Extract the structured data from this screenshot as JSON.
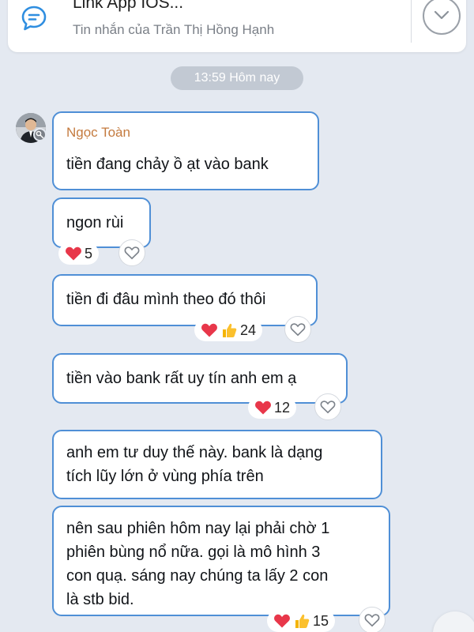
{
  "pinned": {
    "title": "Link App IOS...",
    "subtitle": "Tin nhắn của Trần Thị Hồng Hạnh",
    "icon": "chat-bubble-icon"
  },
  "time_divider": "13:59 Hôm nay",
  "sender": {
    "name": "Ngọc Toàn"
  },
  "messages": [
    {
      "text": "tiền đang chảy ồ ạt vào bank"
    },
    {
      "text": "ngon rùi",
      "reaction_count": "5"
    },
    {
      "text": "tiền đi đâu mình theo đó thôi",
      "reaction_count": "24"
    },
    {
      "text": "tiền vào bank rất uy tín anh em ạ",
      "reaction_count": "12"
    },
    {
      "lines": [
        "anh em tư duy thế này. bank là dạng",
        "tích lũy lớn ở vùng phía trên"
      ]
    },
    {
      "lines": [
        "nên sau phiên hôm nay lại phải chờ 1",
        "phiên bùng nổ nữa. gọi là mô hình 3",
        "con quạ. sáng nay chúng ta lấy 2 con",
        "là stb bid."
      ],
      "reaction_count": "15"
    }
  ],
  "colors": {
    "background": "#e4e9f1",
    "bubble_border": "#4f8fd6",
    "sender_name": "#c47a3e",
    "time_pill": "#c2c9d3"
  }
}
